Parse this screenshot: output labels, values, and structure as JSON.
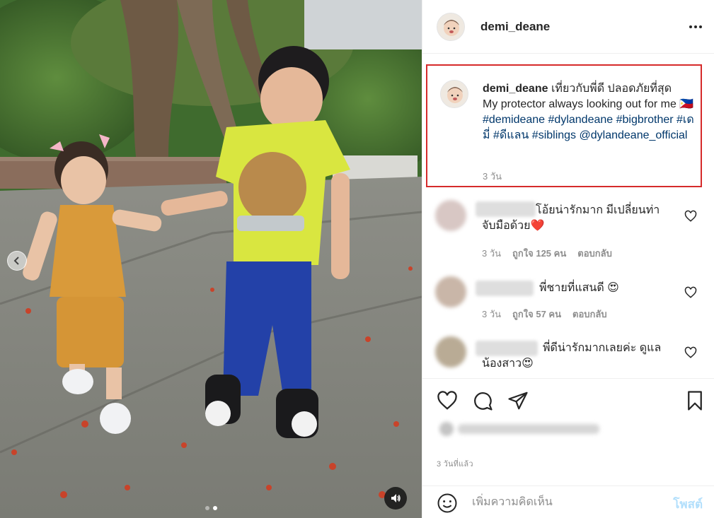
{
  "post": {
    "username": "demi_deane",
    "more_icon": "more-horizontal-icon"
  },
  "caption": {
    "username": "demi_deane",
    "line_thai": "เที่ยวกับพี่ดี ปลอดภัยที่สุด",
    "line_en": "My protector always looking out for me",
    "emoji": "🇵🇭",
    "hashtags": [
      "#demideane",
      "#dylandeane",
      "#bigbrother",
      "#เดมี่",
      "#ดีแลน",
      "#siblings"
    ],
    "mention": "@dylandeane_official",
    "time": "3 วัน"
  },
  "comments": [
    {
      "text_line1": "โอ้ยน่ารักมาก มีเปลี่ยนท่า",
      "text_line2": "จับมือด้วย❤️",
      "time": "3 วัน",
      "likes": "ถูกใจ 125 คน",
      "reply": "ตอบกลับ"
    },
    {
      "text_line1": "พี่ชายที่แสนดี 😍",
      "time": "3 วัน",
      "likes": "ถูกใจ 57 คน",
      "reply": "ตอบกลับ"
    },
    {
      "text_line1": "พี่ดีน่ารักมากเลยค่ะ ดูแล",
      "text_line2": "น้องสาว😍"
    }
  ],
  "actions": {
    "like_icon": "heart-icon",
    "comment_icon": "comment-icon",
    "share_icon": "paper-plane-icon",
    "save_icon": "bookmark-icon"
  },
  "post_age": "3 วันที่แล้ว",
  "comment_box": {
    "placeholder": "เพิ่มความคิดเห็น",
    "post_label": "โพสต์"
  },
  "colors": {
    "highlight_border": "#d62b2b",
    "hashtag": "#00376b",
    "post_button_disabled": "#b2dffc",
    "muted_text": "#8e8e8e"
  }
}
